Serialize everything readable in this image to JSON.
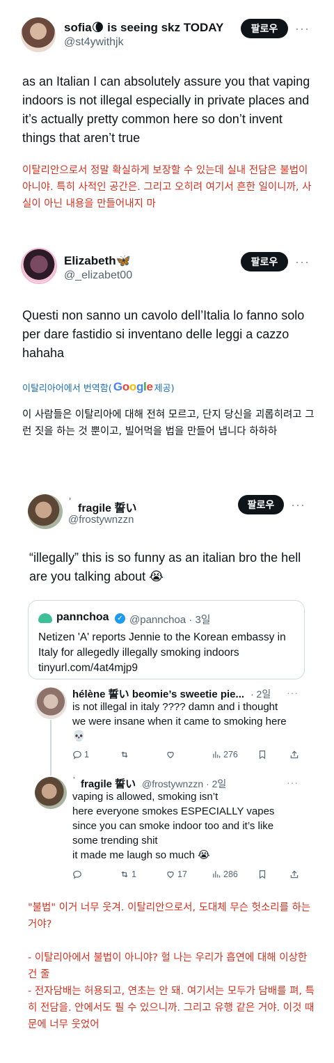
{
  "tweet1": {
    "display_name": "sofia🌘 is seeing skz TODAY",
    "handle": "@st4ywithjk",
    "follow_label": "팔로우",
    "more": "···",
    "text": "as an Italian I can absolutely assure you that vaping indoors is not illegal especially in private places and it’s actually pretty common here so don’t invent things that aren’t true",
    "translation": "이탈리안으로서 정말 확실하게 보장할 수 있는데 실내 전담은 불법이 아니야. 특히 사적인 공간은. 그리고 오히려 여기서 흔한 일이니까, 사실이 아닌 내용을 만들어내지 마"
  },
  "tweet2": {
    "display_name": "Elizabeth🦋",
    "handle": "@_elizabet00",
    "follow_label": "팔로우",
    "more": "···",
    "text": "Questi non sanno un cavolo dell’Italia lo fanno solo per dare fastidio si  inventano delle leggi a cazzo hahaha",
    "translated_prefix": "이탈리아어에서 번역함(",
    "google": "Google",
    "translated_suffix": " 제공)",
    "translation": "이 사람들은 이탈리아에 대해 전혀 모르고, 단지 당신을 괴롭히려고 그런 짓을 하는 것 뿐이고, 빌어먹을 법을 만들어 냅니다 하하하"
  },
  "tweet3": {
    "display_name": "fragile 誓い",
    "handle": "@frostywnzzn",
    "follow_label": "팔로우",
    "more": "···",
    "text": "“illegally” this is so funny as an italian bro the hell are you talking about 😭",
    "quote": {
      "name": "pannchoa",
      "handle_time": "@pannchoa · 3일",
      "text": "Netizen 'A' reports Jennie to the Korean embassy in Italy for allegedly illegally smoking indoors",
      "link": "tinyurl.com/4at4mjp9"
    },
    "reply1": {
      "name": "hélène 誓い beomie’s sweetie pie...",
      "time": "· 2일",
      "text": "is not illegal in italy ???? damn and i thought we were insane when it came to smoking here 💀",
      "replies": "1",
      "retweets": "",
      "likes": "",
      "views": "276"
    },
    "reply2": {
      "name": "fragile 誓い",
      "handle_time": "@frostywnzzn · 2일",
      "text": "vaping is allowed, smoking isn’t\nhere everyone smokes ESPECIALLY vapes since you can smoke indoor too and it’s like some trending shit\nit made me laugh so much 😭",
      "replies": "",
      "retweets": "1",
      "likes": "17",
      "views": "286"
    },
    "translation": "\"불법\" 이거 너무 웃겨. 이탈리안으로서, 도대체 무슨 헛소리를 하는 거야?\n\n- 이탈리아에서 불법이 아니야? 헐 나는 우리가 흡연에 대해 이상한 건 줄\n- 전자담배는 허용되고, 연초는 안 돼. 여기서는 모두가 담배를 펴, 특히 전담을. 안에서도 필 수 있으니까. 그리고 유행 같은 거야. 이것 때문에 너무 웃었어"
  },
  "colors": {
    "translation_red": "#d6301f",
    "link_blue": "#1d6fb8",
    "button_bg": "#0f1419",
    "muted": "#536471"
  }
}
